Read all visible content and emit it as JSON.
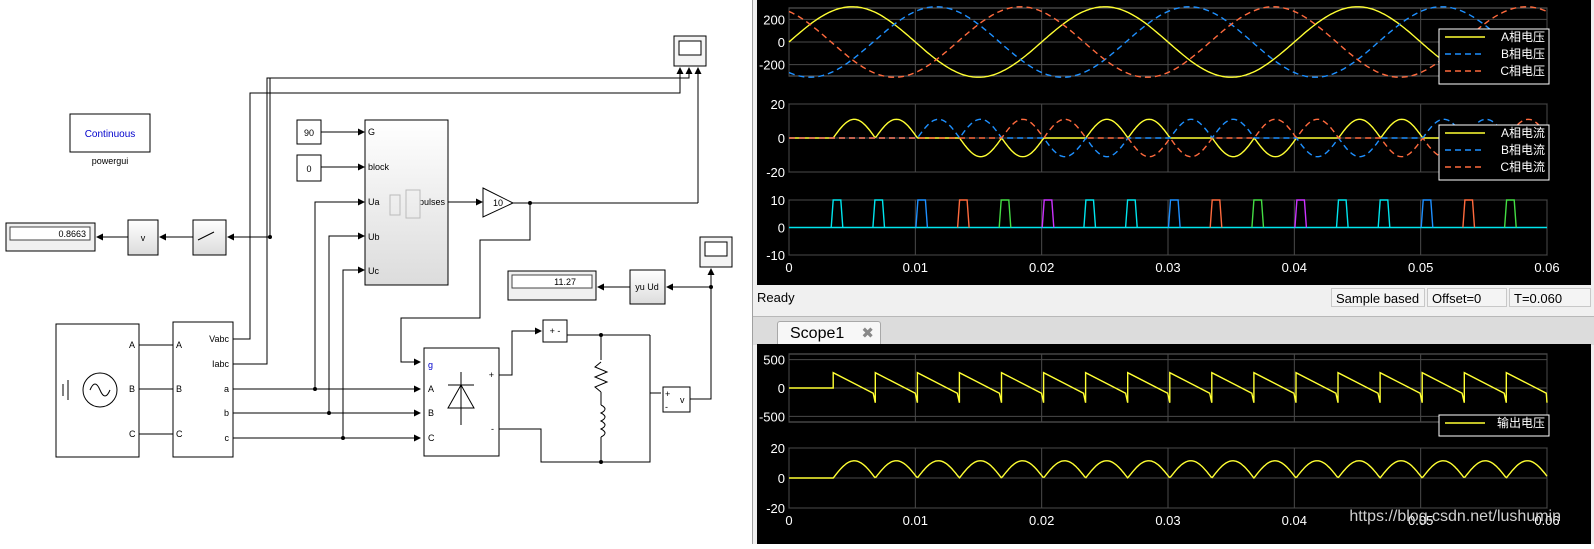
{
  "diagram": {
    "powergui": {
      "mode": "Continuous",
      "caption": "powergui"
    },
    "display1": {
      "value": "0.8663"
    },
    "display2": {
      "value": "11.27"
    },
    "const_alpha": "90",
    "const_block": "0",
    "gain": "10",
    "pulse_gen": {
      "in_g": "G",
      "in_block": "block",
      "in_ua": "Ua",
      "in_ub": "Ub",
      "in_uc": "Uc",
      "out": "pulses"
    },
    "measure": {
      "out1": "Vabc",
      "out2": "Iabc",
      "a": "a",
      "b": "b",
      "c": "c",
      "in_a": "A",
      "in_b": "B",
      "in_c": "C"
    },
    "source_ports": {
      "a": "A",
      "b": "B",
      "c": "C"
    },
    "rectifier": {
      "g": "g",
      "a": "A",
      "b": "B",
      "c": "C",
      "plus": "+",
      "minus": "-"
    },
    "fcn_block": "yu  Ud",
    "v_block": "v",
    "sum_block": "+ -",
    "vm_block": "v",
    "vm_plus": "+",
    "vm_minus": "-"
  },
  "scope_top": {
    "axes": [
      {
        "yticks": [
          "200",
          "0",
          "-200"
        ],
        "legend": [
          "A相电压",
          "B相电压",
          "C相电压"
        ]
      },
      {
        "yticks": [
          "20",
          "0",
          "-20"
        ],
        "legend": [
          "A相电流",
          "B相电流",
          "C相电流"
        ]
      },
      {
        "yticks": [
          "10",
          "0",
          "-10"
        ],
        "legend": []
      }
    ],
    "xticks": [
      "0",
      "0.01",
      "0.02",
      "0.03",
      "0.04",
      "0.05",
      "0.06"
    ],
    "status": {
      "ready": "Ready",
      "mode": "Sample based",
      "offset": "Offset=0",
      "time": "T=0.060"
    }
  },
  "scope_bottom": {
    "tab": "Scope1",
    "axes": [
      {
        "yticks": [
          "500",
          "0",
          "-500"
        ],
        "legend": [
          "输出电压"
        ]
      },
      {
        "yticks": [
          "20",
          "0",
          "-20"
        ],
        "legend": []
      }
    ],
    "xticks": [
      "0",
      "0.01",
      "0.02",
      "0.03",
      "0.04",
      "0.05",
      "0.06"
    ]
  },
  "watermark": "https://blog.csdn.net/lushumin",
  "colors": {
    "phaseA": "#ffff33",
    "phaseB": "#1e90ff",
    "phaseC": "#ff6a3d",
    "pulse_cyan": "#00e5ee",
    "pulse_purple": "#cc33ff",
    "pulse_green": "#44dd44"
  },
  "chart_data": [
    {
      "type": "line",
      "title": "",
      "xlim": [
        0,
        0.06
      ],
      "ylim": [
        -300,
        300
      ],
      "series": [
        {
          "name": "A相电压",
          "amplitude": 311,
          "frequency_hz": 50,
          "phase_deg": 0
        },
        {
          "name": "B相电压",
          "amplitude": 311,
          "frequency_hz": 50,
          "phase_deg": -120
        },
        {
          "name": "C相电压",
          "amplitude": 311,
          "frequency_hz": 50,
          "phase_deg": 120
        }
      ]
    },
    {
      "type": "line",
      "title": "",
      "xlim": [
        0,
        0.06
      ],
      "ylim": [
        -20,
        20
      ],
      "series": [
        {
          "name": "A相电流",
          "peak": 11
        },
        {
          "name": "B相电流",
          "peak": 11
        },
        {
          "name": "C相电流",
          "peak": 11
        }
      ]
    },
    {
      "type": "line",
      "title": "",
      "xlim": [
        0,
        0.06
      ],
      "ylim": [
        -10,
        10
      ],
      "pulse_height": 10,
      "pulse_times": [
        0.0035,
        0.0068,
        0.0102,
        0.0135,
        0.0168,
        0.0202,
        0.0235,
        0.0268,
        0.0302,
        0.0335,
        0.0368,
        0.0402,
        0.0435,
        0.0468,
        0.0502,
        0.0535,
        0.0568
      ]
    },
    {
      "type": "line",
      "title": "",
      "xlim": [
        0,
        0.06
      ],
      "ylim": [
        -600,
        600
      ],
      "series": [
        {
          "name": "输出电压",
          "start_time": 0.0035,
          "peak": 270,
          "trough": -260,
          "period": 0.00333
        }
      ]
    },
    {
      "type": "line",
      "title": "",
      "xlim": [
        0,
        0.06
      ],
      "ylim": [
        -20,
        20
      ],
      "series": [
        {
          "name": "",
          "start_time": 0.0035,
          "peak": 11.5,
          "period": 0.00333
        }
      ]
    }
  ]
}
